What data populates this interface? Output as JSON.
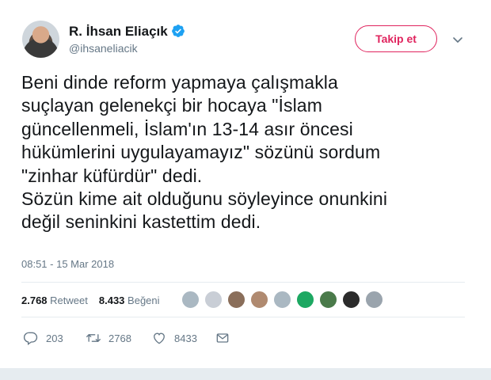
{
  "author": {
    "name": "R. İhsan Eliaçık",
    "handle": "@ihsaneliacik",
    "verified_icon": "verified-badge-icon",
    "avatar_icon": "profile-photo"
  },
  "header": {
    "follow_label": "Takip et",
    "menu_icon": "chevron-down-icon"
  },
  "tweet": {
    "text": "Beni dinde reform yapmaya çalışmakla\nsuçlayan gelenekçi bir hocaya \"İslam\ngüncellenmeli, İslam'ın 13-14 asır öncesi\nhükümlerini uygulayamayız\" sözünü sordum\n\"zinhar küfürdür\" dedi.\nSözün kime ait olduğunu söyleyince onunkini\ndeğil seninkini kastettim dedi.",
    "timestamp": "08:51 - 15 Mar 2018"
  },
  "stats": {
    "retweets_count": "2.768",
    "retweets_label": "Retweet",
    "likes_count": "8.433",
    "likes_label": "Beğeni"
  },
  "likers": [
    {
      "color": "#aab8c2"
    },
    {
      "color": "#c9ced6"
    },
    {
      "color": "#8a6e5a"
    },
    {
      "color": "#b08a70"
    },
    {
      "color": "#aab8c2"
    },
    {
      "color": "#1da862"
    },
    {
      "color": "#4a7a4a"
    },
    {
      "color": "#2b2b2b"
    },
    {
      "color": "#9aa4ad"
    }
  ],
  "actions": {
    "reply_count": "203",
    "retweet_count": "2768",
    "like_count": "8433"
  },
  "colors": {
    "accent": "#e0245e",
    "verified": "#1da1f2",
    "secondary_text": "#657786"
  }
}
